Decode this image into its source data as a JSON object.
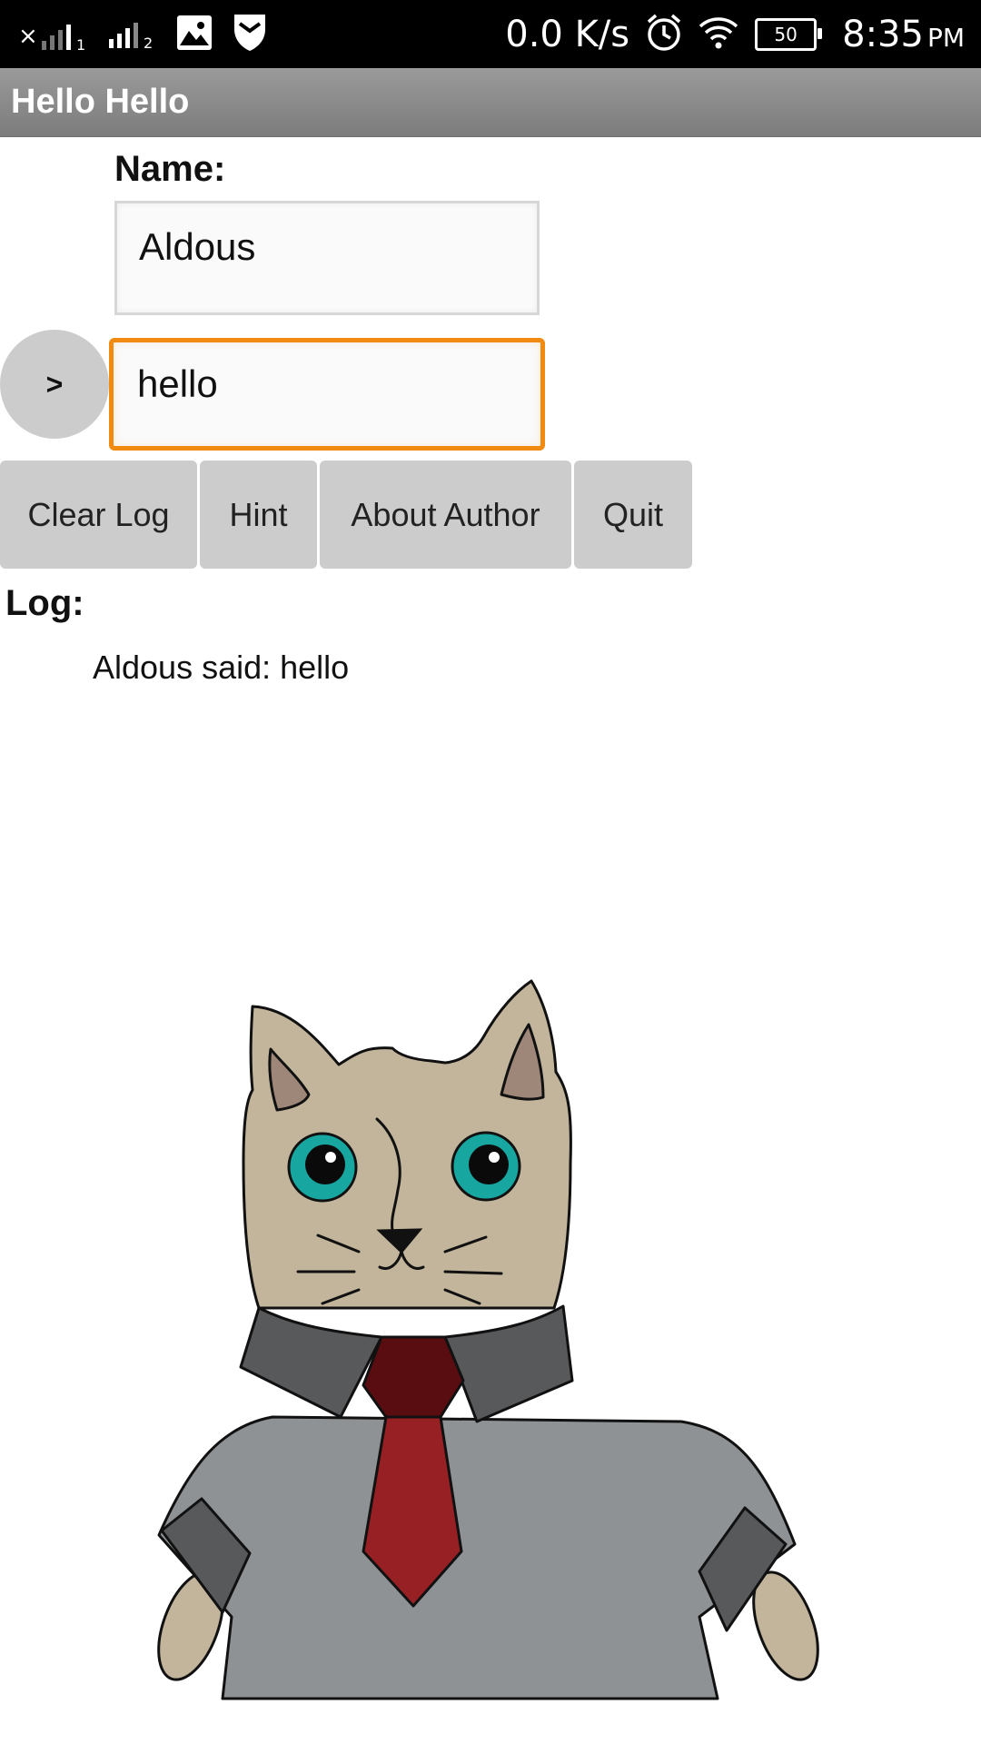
{
  "status_bar": {
    "sim1": "×",
    "sim1_index": "1",
    "sim2_index": "2",
    "speed": "0.0 K/s",
    "battery": "50",
    "time": "8:35",
    "ampm": "PM"
  },
  "app": {
    "title": "Hello Hello"
  },
  "form": {
    "name_label": "Name:",
    "name_value": "Aldous",
    "message_value": "hello",
    "send_label": ">"
  },
  "buttons": {
    "clear_log": "Clear Log",
    "hint": "Hint",
    "about_author": "About Author",
    "quit": "Quit"
  },
  "log": {
    "label": "Log:",
    "entries": [
      "Aldous said: hello"
    ]
  },
  "colors": {
    "focus_border": "#f08a10",
    "button_bg": "#cccccc",
    "titlebar": "#8a8a8a",
    "cat_fur": "#c2b59b",
    "cat_eyes": "#18a6a0",
    "tie": "#962024",
    "shirt": "#8e9294",
    "collar": "#58595b"
  },
  "icons": [
    "signal-sim1-icon",
    "signal-sim2-icon",
    "gallery-notification-icon",
    "shield-notification-icon",
    "alarm-icon",
    "wifi-icon",
    "battery-icon"
  ]
}
